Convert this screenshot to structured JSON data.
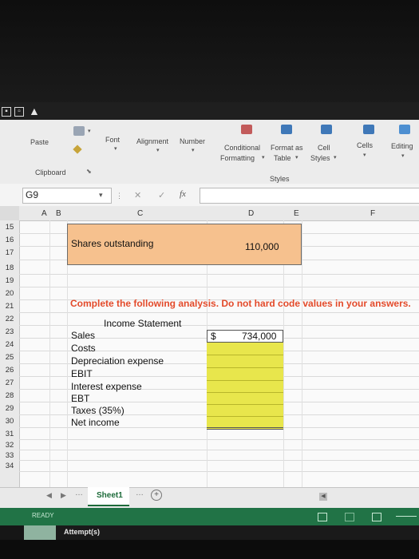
{
  "ribbon": {
    "paste": "Paste",
    "font": "Font",
    "alignment": "Alignment",
    "number": "Number",
    "conditional_formatting_line1": "Conditional",
    "conditional_formatting_line2": "Formatting",
    "format_as_table_line1": "Format as",
    "format_as_table_line2": "Table",
    "cell_styles_line1": "Cell",
    "cell_styles_line2": "Styles",
    "cells": "Cells",
    "editing": "Editing",
    "clipboard_group": "Clipboard",
    "styles_group": "Styles"
  },
  "formula_bar": {
    "name_box": "G9",
    "fx": "fx",
    "cancel": "✕",
    "enter": "✓"
  },
  "columns": [
    "A",
    "B",
    "C",
    "D",
    "E",
    "F"
  ],
  "rows": [
    "15",
    "16",
    "17",
    "18",
    "19",
    "20",
    "21",
    "22",
    "23",
    "24",
    "25",
    "26",
    "27",
    "28",
    "29",
    "30",
    "31",
    "32",
    "33",
    "34"
  ],
  "cells": {
    "shares_label": "Shares outstanding",
    "shares_value": "110,000",
    "instruction": "Complete the following analysis. Do not hard code values in your answers.",
    "income_statement_title": "Income Statement",
    "dollar_sign": "$",
    "sales_value": "734,000"
  },
  "income_items": [
    "Sales",
    "Costs",
    "Depreciation expense",
    "EBIT",
    "Interest expense",
    "EBT",
    "Taxes (35%)",
    "Net income"
  ],
  "sheet_tab": "Sheet1",
  "status": {
    "ready": "READY",
    "attempts": "Attempt(s)"
  },
  "colors": {
    "excel_green": "#217346",
    "input_orange": "#f6c18e",
    "answer_yellow": "#e8e64c",
    "instruction_red": "#e34a2a"
  }
}
